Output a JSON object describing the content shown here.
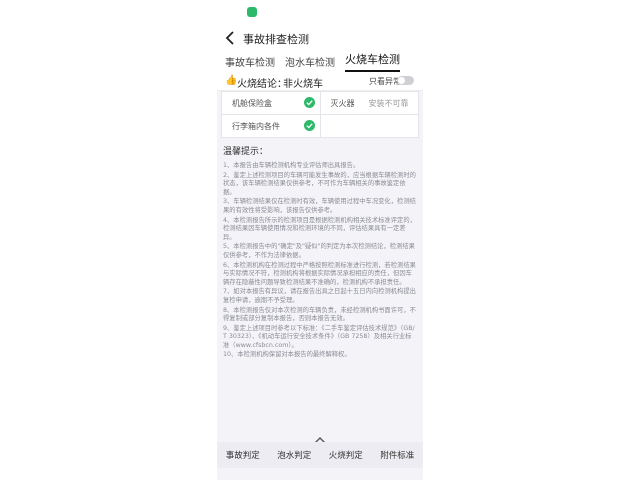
{
  "header": {
    "title": "事故排查检测"
  },
  "tabs": [
    "事故车检测",
    "泡水车检测",
    "火烧车检测"
  ],
  "result": {
    "label": "火烧结论：",
    "value": "非火烧车",
    "toggle_label": "只看异常"
  },
  "table": {
    "rows": [
      {
        "left": "机舱保险盒",
        "right": "灭火器",
        "right_status": "安装不可靠"
      },
      {
        "left": "行李箱内各件",
        "right": ""
      }
    ]
  },
  "notice": {
    "title": "温馨提示：",
    "paragraphs": [
      "1、本报告由车辆检测机构专业评估师出具报告。",
      "2、鉴定上述检测项目的车辆可能发生事故的，应当根据车辆检测时的状态，该车辆检测结果仅供参考，不可作为车辆相关的事故鉴定依据。",
      "3、车辆检测结果仅在检测时有效，车辆使用过程中车况变化，检测结果的有效性将受影响，该报告仅供参考。",
      "4、本检测报告所示的检测项目是根据检测机构相关技术标准评定的，检测结果因车辆使用情况和检测环境的不同，评估结果具有一定差异。",
      "5、本检测报告中的\"确定\"及\"疑似\"的判定为本次检测结论，检测结果仅供参考，不作为法律依据。",
      "6、本检测机构在检测过程中严格按照检测标准进行检测，若检测结果与实际情况不符，检测机构将根据实际情况承担相应的责任，但因车辆存在隐蔽性问题导致检测结果不准确的，检测机构不承担责任。",
      "7、如对本报告有异议，请在报告出具之日起十五日内向检测机构提出复检申请，逾期不予受理。",
      "8、本检测报告仅对本次检测的车辆负责，未经检测机构书面许可，不得复制或部分复制本报告，否则本报告无效。",
      "9、鉴定上述项目时参考以下标准：《二手车鉴定评估技术规范》（GB/T 30323）、《机动车运行安全技术条件》（GB 7258）及相关行业标准（www.cfsbcn.com）。",
      "10、本检测机构保留对本报告的最终解释权。"
    ]
  },
  "bottom_tabs": [
    "事故判定",
    "泡水判定",
    "火烧判定",
    "附件标准"
  ],
  "colors": {
    "accent": "#2db96a",
    "fire": "#e8731a"
  }
}
